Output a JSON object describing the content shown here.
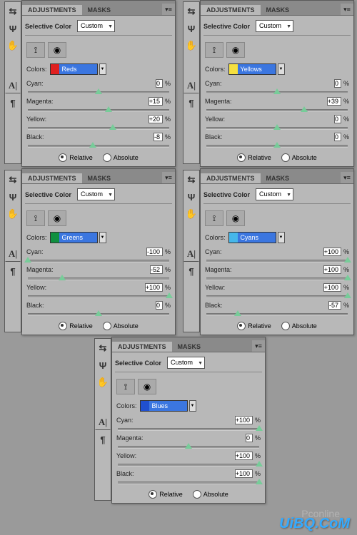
{
  "tabs": {
    "adjustments": "ADJUSTMENTS",
    "masks": "MASKS"
  },
  "title": "Selective Color",
  "preset": "Custom",
  "colors_label": "Colors:",
  "sliders": [
    "Cyan:",
    "Magenta:",
    "Yellow:",
    "Black:"
  ],
  "percent": "%",
  "modes": {
    "relative": "Relative",
    "absolute": "Absolute"
  },
  "watermark": "UiBQ.CoM",
  "wm2": "Pconline",
  "panels": [
    {
      "color": "Reds",
      "swatch": "#e02020",
      "swatch2": "#3b76e0",
      "vals": [
        "0",
        "+15",
        "+20",
        "-8"
      ],
      "pos": [
        50,
        57,
        60,
        46
      ]
    },
    {
      "color": "Yellows",
      "swatch": "#f5e040",
      "swatch2": "#3b76e0",
      "vals": [
        "0",
        "+39",
        "0",
        "0"
      ],
      "pos": [
        50,
        69,
        50,
        50
      ]
    },
    {
      "color": "Greens",
      "swatch": "#109040",
      "swatch2": "#3b76e0",
      "vals": [
        "-100",
        "-52",
        "+100",
        "0"
      ],
      "pos": [
        0,
        24,
        100,
        50
      ]
    },
    {
      "color": "Cyans",
      "swatch": "#46b7ea",
      "swatch2": "#3b76e0",
      "vals": [
        "+100",
        "+100",
        "+100",
        "-57"
      ],
      "pos": [
        100,
        100,
        100,
        22
      ]
    },
    {
      "color": "Blues",
      "swatch": "#2050d0",
      "swatch2": "#3b76e0",
      "vals": [
        "+100",
        "0",
        "+100",
        "+100"
      ],
      "pos": [
        100,
        50,
        100,
        100
      ]
    }
  ],
  "chart_data": [
    {
      "type": "table",
      "title": "Selective Color — Reds",
      "categories": [
        "Cyan",
        "Magenta",
        "Yellow",
        "Black"
      ],
      "values": [
        0,
        15,
        20,
        -8
      ],
      "ylim": [
        -100,
        100
      ]
    },
    {
      "type": "table",
      "title": "Selective Color — Yellows",
      "categories": [
        "Cyan",
        "Magenta",
        "Yellow",
        "Black"
      ],
      "values": [
        0,
        39,
        0,
        0
      ],
      "ylim": [
        -100,
        100
      ]
    },
    {
      "type": "table",
      "title": "Selective Color — Greens",
      "categories": [
        "Cyan",
        "Magenta",
        "Yellow",
        "Black"
      ],
      "values": [
        -100,
        -52,
        100,
        0
      ],
      "ylim": [
        -100,
        100
      ]
    },
    {
      "type": "table",
      "title": "Selective Color — Cyans",
      "categories": [
        "Cyan",
        "Magenta",
        "Yellow",
        "Black"
      ],
      "values": [
        100,
        100,
        100,
        -57
      ],
      "ylim": [
        -100,
        100
      ]
    },
    {
      "type": "table",
      "title": "Selective Color — Blues",
      "categories": [
        "Cyan",
        "Magenta",
        "Yellow",
        "Black"
      ],
      "values": [
        100,
        0,
        100,
        100
      ],
      "ylim": [
        -100,
        100
      ]
    }
  ]
}
